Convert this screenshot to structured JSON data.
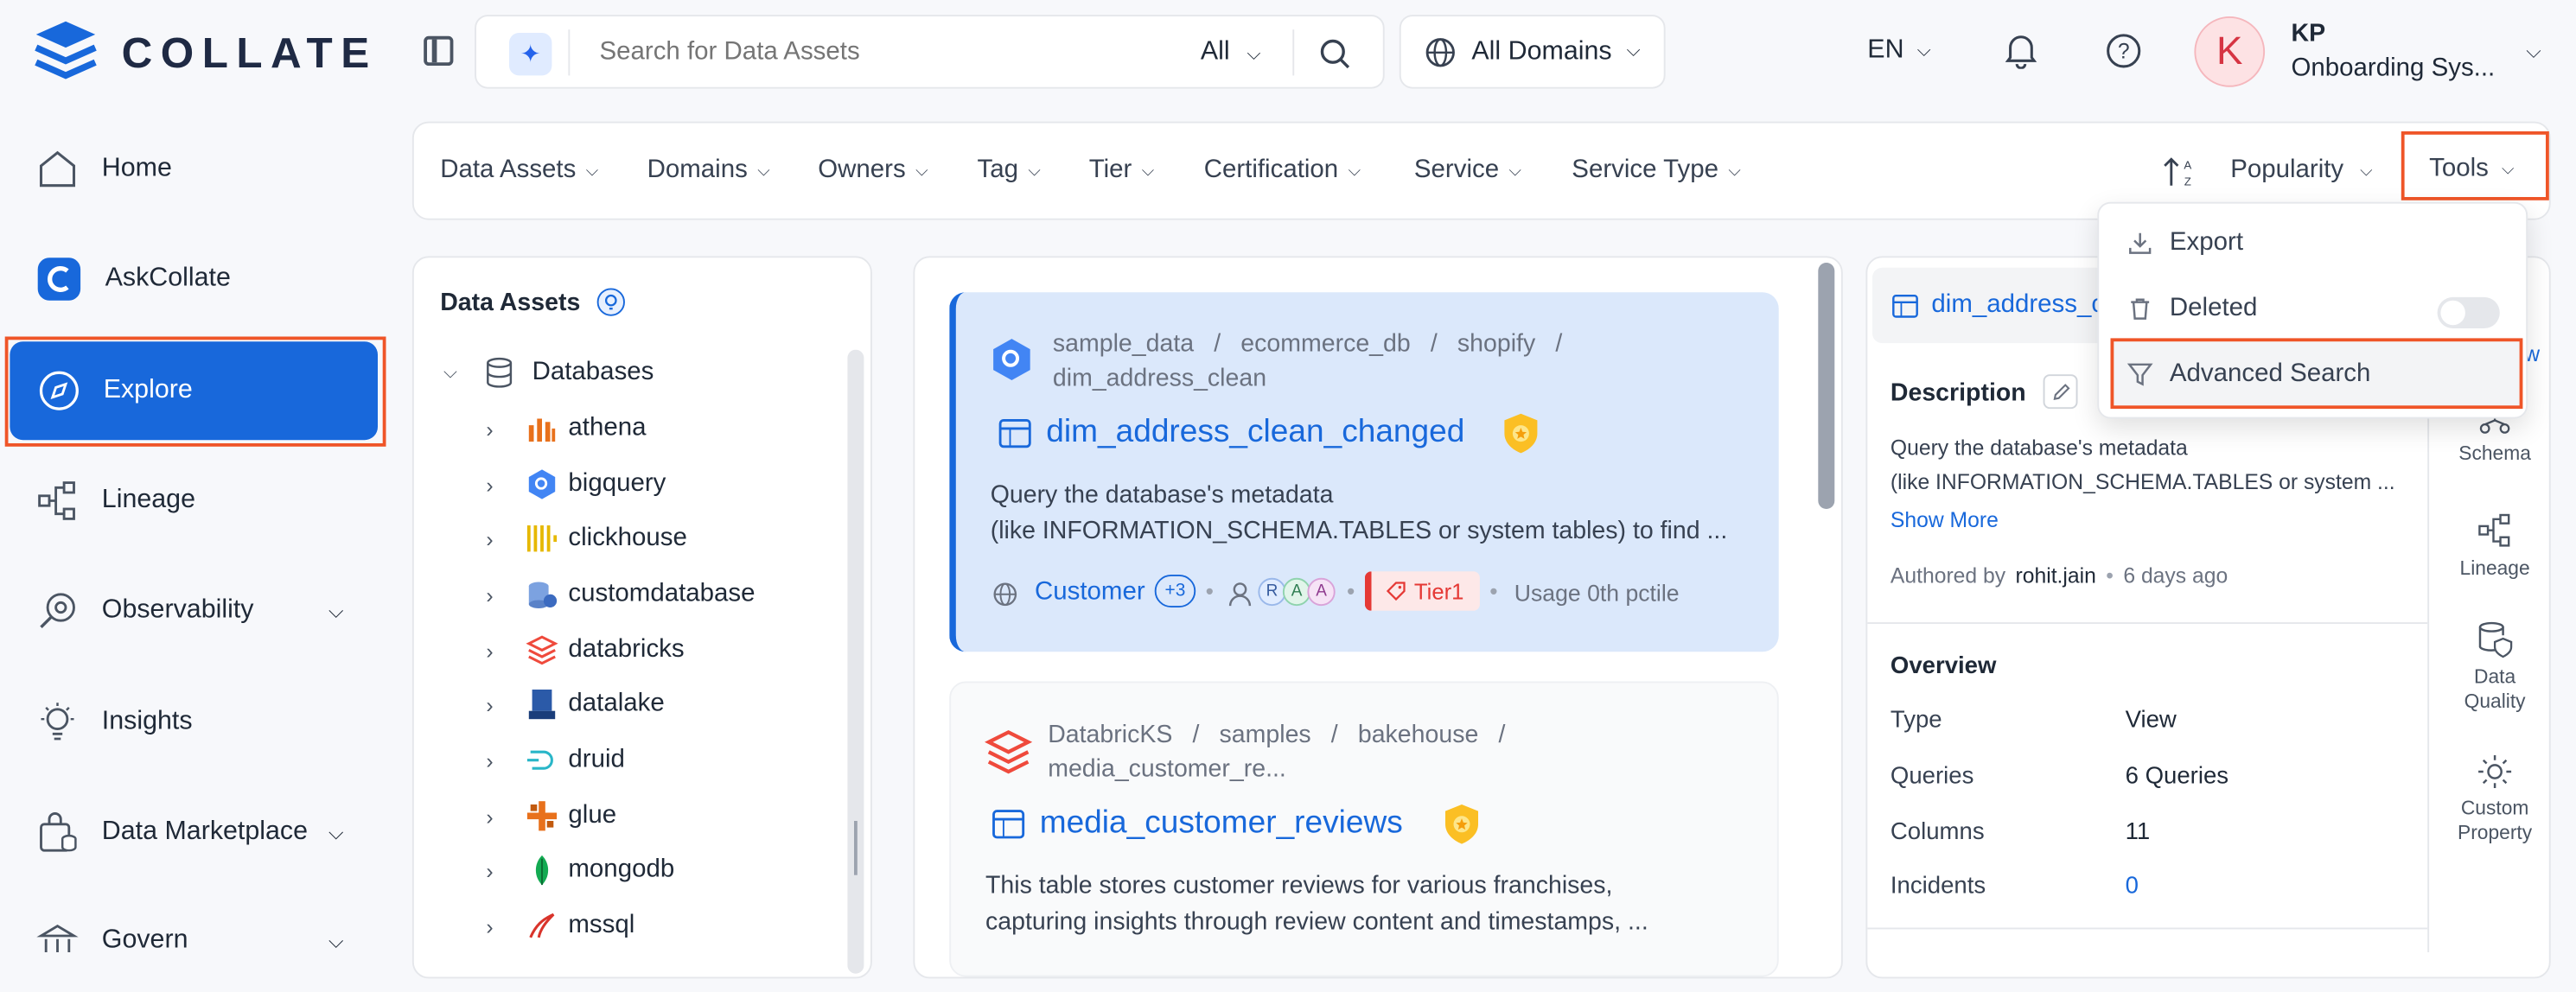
{
  "app": {
    "name": "COLLATE"
  },
  "search": {
    "placeholder": "Search for Data Assets",
    "scope": "All"
  },
  "domain_selector": {
    "label": "All Domains"
  },
  "header": {
    "language": "EN"
  },
  "user": {
    "initial": "K",
    "name": "KP",
    "role": "Onboarding Sys..."
  },
  "sidebar": {
    "items": [
      {
        "label": "Home"
      },
      {
        "label": "AskCollate"
      },
      {
        "label": "Explore"
      },
      {
        "label": "Lineage"
      },
      {
        "label": "Observability"
      },
      {
        "label": "Insights"
      },
      {
        "label": "Data Marketplace"
      },
      {
        "label": "Govern"
      }
    ]
  },
  "filters": [
    "Data Assets",
    "Domains",
    "Owners",
    "Tag",
    "Tier",
    "Certification",
    "Service",
    "Service Type"
  ],
  "sort": {
    "label": "Popularity"
  },
  "tools": {
    "label": "Tools"
  },
  "tools_menu": {
    "export": "Export",
    "deleted": "Deleted",
    "advanced": "Advanced Search"
  },
  "tree": {
    "title": "Data Assets",
    "root": "Databases",
    "items": [
      "athena",
      "bigquery",
      "clickhouse",
      "customdatabase",
      "databricks",
      "datalake",
      "druid",
      "glue",
      "mongodb",
      "mssql"
    ]
  },
  "results": [
    {
      "crumb1": "sample_data",
      "crumb2": "ecommerce_db",
      "crumb3": "shopify",
      "crumb4": "dim_address_clean",
      "title": "dim_address_clean_changed",
      "desc1": "Query the database's metadata",
      "desc2": "(like INFORMATION_SCHEMA.TABLES or system tables) to find ...",
      "domain": "Customer",
      "domain_more": "+3",
      "owners": [
        "R",
        "A",
        "A"
      ],
      "tier": "Tier1",
      "usage": "Usage 0th pctile"
    },
    {
      "crumb1": "DatabricKS",
      "crumb2": "samples",
      "crumb3": "bakehouse",
      "crumb4": "media_customer_re...",
      "title": "media_customer_reviews",
      "desc1": "This table stores customer reviews for various franchises,",
      "desc2": "capturing insights through review content and timestamps, ..."
    }
  ],
  "details": {
    "title": "dim_address_c",
    "description_label": "Description",
    "desc1": "Query the database's metadata",
    "desc2": "(like INFORMATION_SCHEMA.TABLES or system ...",
    "show_more": "Show More",
    "authored_prefix": "Authored by",
    "author": "rohit.jain",
    "authored_when": "6 days ago",
    "overview_label": "Overview",
    "overview": [
      {
        "key": "Type",
        "value": "View"
      },
      {
        "key": "Queries",
        "value": "6 Queries"
      },
      {
        "key": "Columns",
        "value": "11"
      },
      {
        "key": "Incidents",
        "value": "0"
      }
    ],
    "view_link": "w"
  },
  "rail": {
    "schema": "Schema",
    "lineage": "Lineage",
    "dq1": "Data",
    "dq2": "Quality",
    "cp1": "Custom",
    "cp2": "Property"
  },
  "colors": {
    "accent": "#1868db",
    "highlight": "#ef5528",
    "tier": "#e53935"
  }
}
